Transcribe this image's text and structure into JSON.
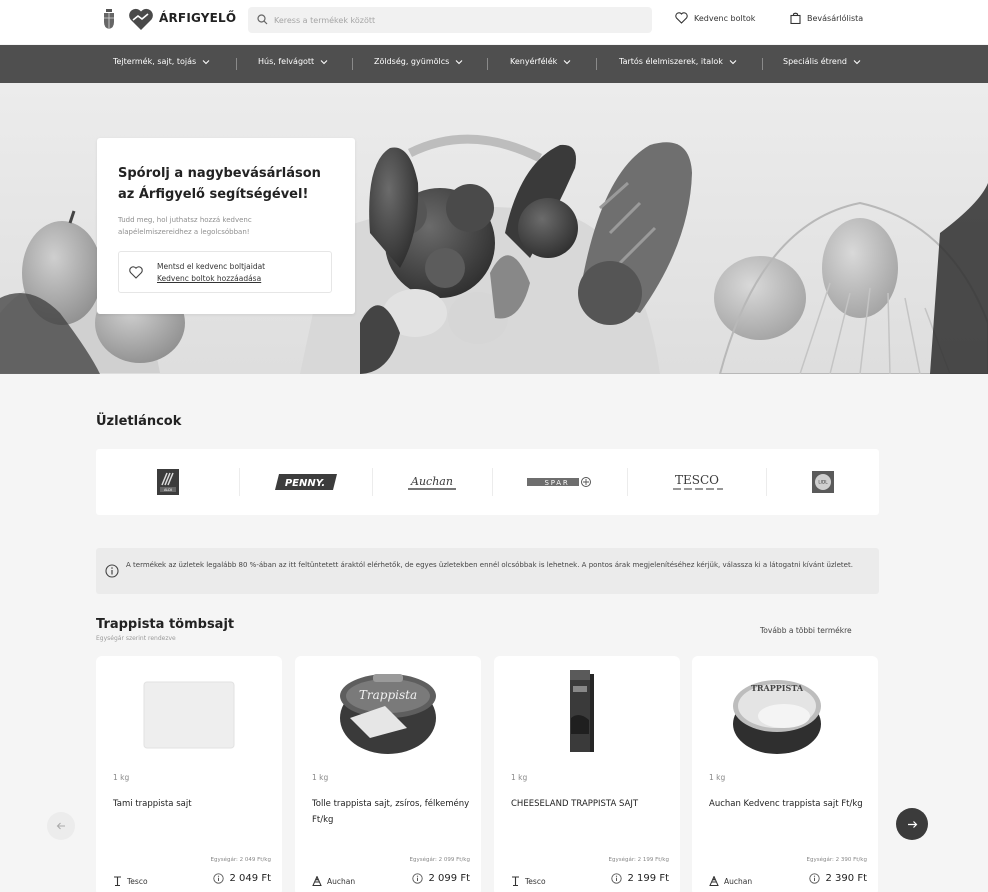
{
  "header": {
    "logo_text": "ÁRFIGYELŐ",
    "search_placeholder": "Keress a termékek között",
    "favorites_label": "Kedvenc boltok",
    "shopping_list_label": "Bevásárlólista"
  },
  "nav": {
    "items": [
      {
        "label": "Tejtermék, sajt, tojás"
      },
      {
        "label": "Hús, felvágott"
      },
      {
        "label": "Zöldség, gyümölcs"
      },
      {
        "label": "Kenyérfélék"
      },
      {
        "label": "Tartós élelmiszerek, italok"
      },
      {
        "label": "Speciális étrend"
      }
    ]
  },
  "hero": {
    "title": "Spórolj a nagybevásárláson az Árfigyelő segítségével!",
    "subtitle": "Tudd meg, hol juthatsz hozzá kedvenc alapélelmiszereidhez a legolcsóbban!",
    "fav_text": "Mentsd el kedvenc boltjaidat",
    "fav_link": "Kedvenc boltok hozzáadása"
  },
  "stores": {
    "title": "Üzletláncok",
    "items": [
      {
        "name": "ALDI"
      },
      {
        "name": "PENNY."
      },
      {
        "name": "Auchan"
      },
      {
        "name": "SPAR"
      },
      {
        "name": "TESCO"
      },
      {
        "name": "LIDL"
      }
    ]
  },
  "info": {
    "text": "A termékek az üzletek legalább 80 %-ában az itt feltüntetett áraktól elérhetők, de egyes üzletekben ennél olcsóbbak is lehetnek. A pontos árak megjelenítéséhez kérjük, válassza ki a látogatni kívánt üzletet."
  },
  "products": {
    "title": "Trappista tömbsajt",
    "subtitle": "Egységár szerint rendezve",
    "more_link": "Tovább a többi termékre",
    "items": [
      {
        "weight": "1 kg",
        "name": "Tami trappista sajt",
        "unit_price": "Egységár: 2 049 Ft/kg",
        "store": "Tesco",
        "price": "2 049 Ft"
      },
      {
        "weight": "1 kg",
        "name": "Tolle trappista sajt, zsíros, félkemény Ft/kg",
        "unit_price": "Egységár: 2 099 Ft/kg",
        "store": "Auchan",
        "price": "2 099 Ft"
      },
      {
        "weight": "1 kg",
        "name": "CHEESELAND TRAPPISTA SAJT",
        "unit_price": "Egységár: 2 199 Ft/kg",
        "store": "Tesco",
        "price": "2 199 Ft"
      },
      {
        "weight": "1 kg",
        "name": "Auchan Kedvenc trappista sajt Ft/kg",
        "unit_price": "Egységár: 2 390 Ft/kg",
        "store": "Auchan",
        "price": "2 390 Ft"
      }
    ]
  }
}
